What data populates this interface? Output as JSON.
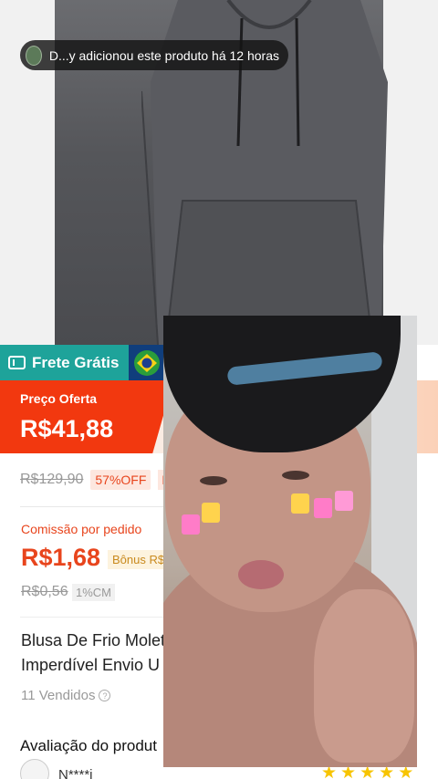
{
  "notification": {
    "text": "D...y adicionou este produto há 12 horas"
  },
  "badges": {
    "frete": "Frete Grátis",
    "flag": "brazil-flag-icon"
  },
  "price": {
    "label": "Preço Oferta",
    "current": "R$41,88",
    "original": "R$129,90",
    "discount": "57%OFF",
    "extra_badge_partial": "P"
  },
  "commission": {
    "label": "Comissão por pedido",
    "value": "R$1,68",
    "bonus_partial": "Bônus R$",
    "old": "R$0,56",
    "rate": "1%CM"
  },
  "product": {
    "title_line1": "Blusa De Frio Molet",
    "title_line2": "Imperdível Envio U",
    "sold": "11 Vendidos"
  },
  "reviews": {
    "heading": "Avaliação do produt",
    "reviewer": "N****i",
    "rating": 5
  },
  "colors": {
    "accent": "#f2380f",
    "frete_bg": "#1ea39a",
    "discount_text": "#e8451d",
    "star": "#f7c400"
  }
}
